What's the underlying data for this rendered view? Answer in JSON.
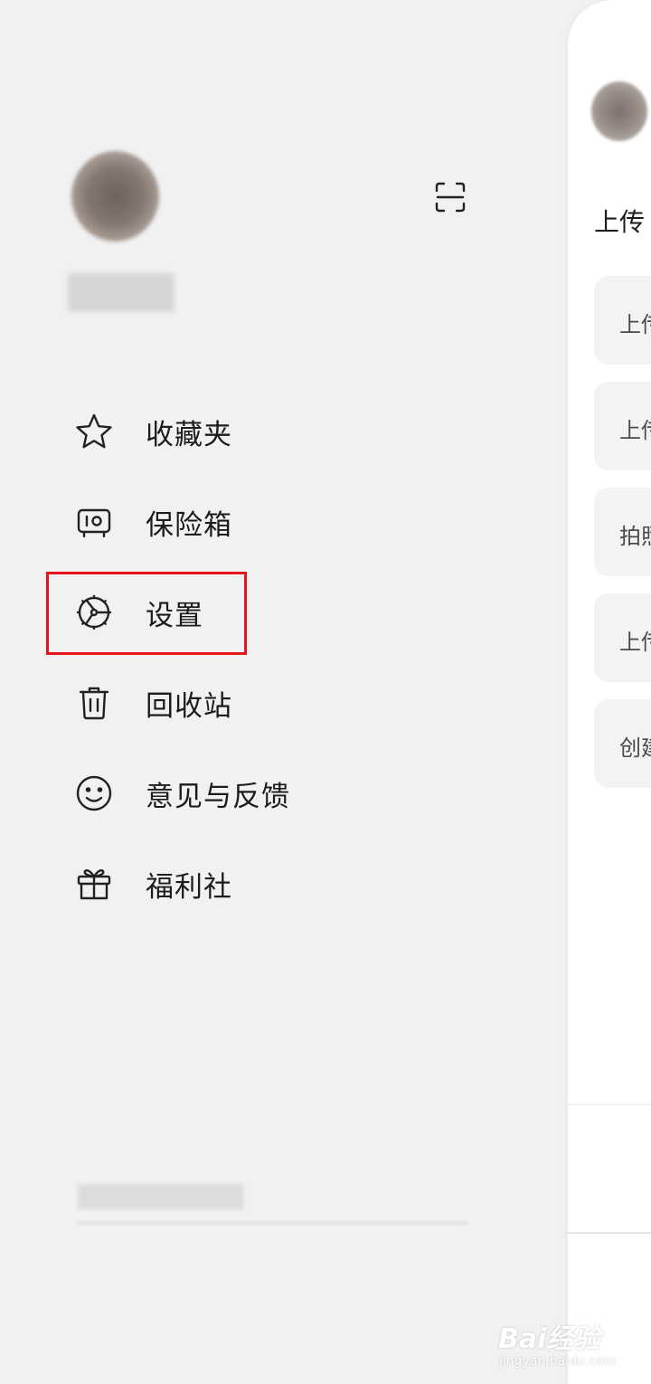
{
  "drawer": {
    "menu": [
      {
        "id": "favorites",
        "label": "收藏夹",
        "icon": "star-icon"
      },
      {
        "id": "vault",
        "label": "保险箱",
        "icon": "safe-icon"
      },
      {
        "id": "settings",
        "label": "设置",
        "icon": "gear-icon"
      },
      {
        "id": "recycle",
        "label": "回收站",
        "icon": "trash-icon"
      },
      {
        "id": "feedback",
        "label": "意见与反馈",
        "icon": "smile-icon"
      },
      {
        "id": "welfare",
        "label": "福利社",
        "icon": "gift-icon"
      }
    ],
    "highlight_color": "#e8141b"
  },
  "main": {
    "title": "上传",
    "options": [
      "上传",
      "上传",
      "拍照",
      "上传",
      "创建"
    ]
  },
  "watermark": {
    "brand": "Bai经验",
    "url": "jingyan.baidu.com"
  }
}
